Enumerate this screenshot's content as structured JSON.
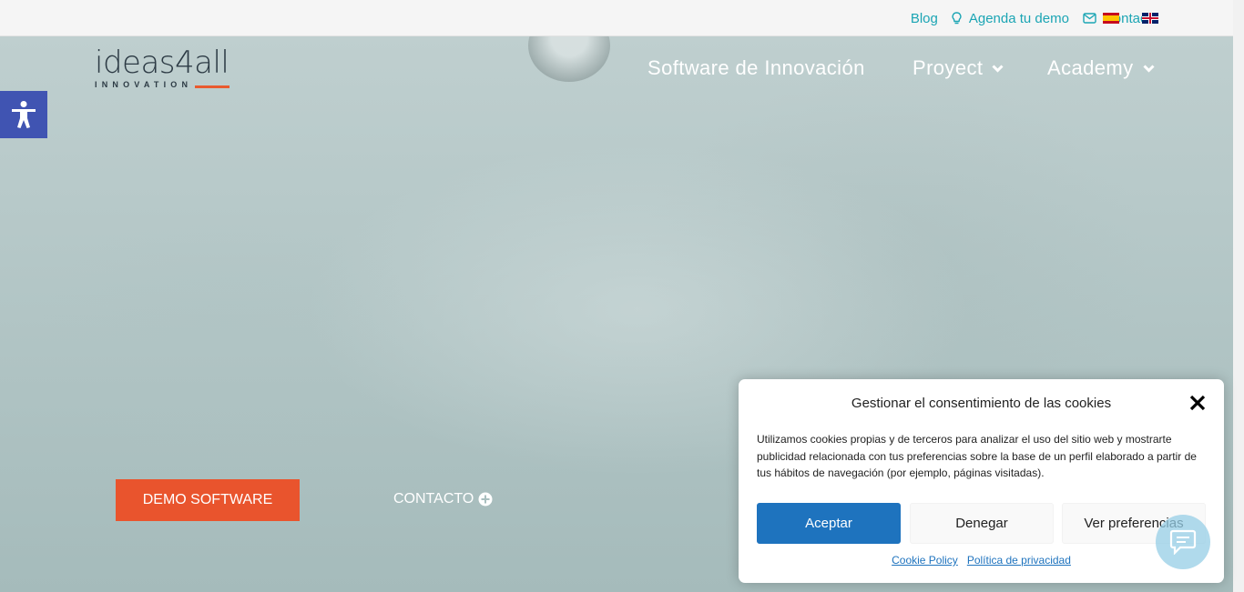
{
  "topbar": {
    "links": [
      {
        "label": "Blog",
        "icon": ""
      },
      {
        "label": "Agenda tu demo",
        "icon": "lightbulb-icon"
      },
      {
        "label": "Contacto",
        "icon": "envelope-icon"
      }
    ],
    "languages": [
      "es",
      "en"
    ]
  },
  "logo": {
    "word": "ideas4all",
    "sub": "INNOVATION"
  },
  "nav": {
    "items": [
      {
        "label": "Software de Innovación"
      },
      {
        "label": "Proyect"
      },
      {
        "label": "Academy"
      }
    ]
  },
  "hero": {
    "demo_button": "DEMO SOFTWARE",
    "contact_button": "CONTACTO"
  },
  "cookie": {
    "title": "Gestionar el consentimiento de las cookies",
    "text": "Utilizamos cookies propias y de terceros para analizar el uso del sitio web y mostrarte publicidad relacionada con tus preferencias sobre la base de un perfil elaborado a partir de tus hábitos de navegación (por ejemplo, páginas visitadas).",
    "accept": "Aceptar",
    "deny": "Denegar",
    "preferences": "Ver preferencias",
    "links": [
      "Cookie Policy",
      "Política de privacidad"
    ]
  },
  "colors": {
    "accent": "#1ba5b4",
    "orange": "#e9542d",
    "accept_blue": "#1e73be",
    "a11y_blue": "#4054b2"
  }
}
